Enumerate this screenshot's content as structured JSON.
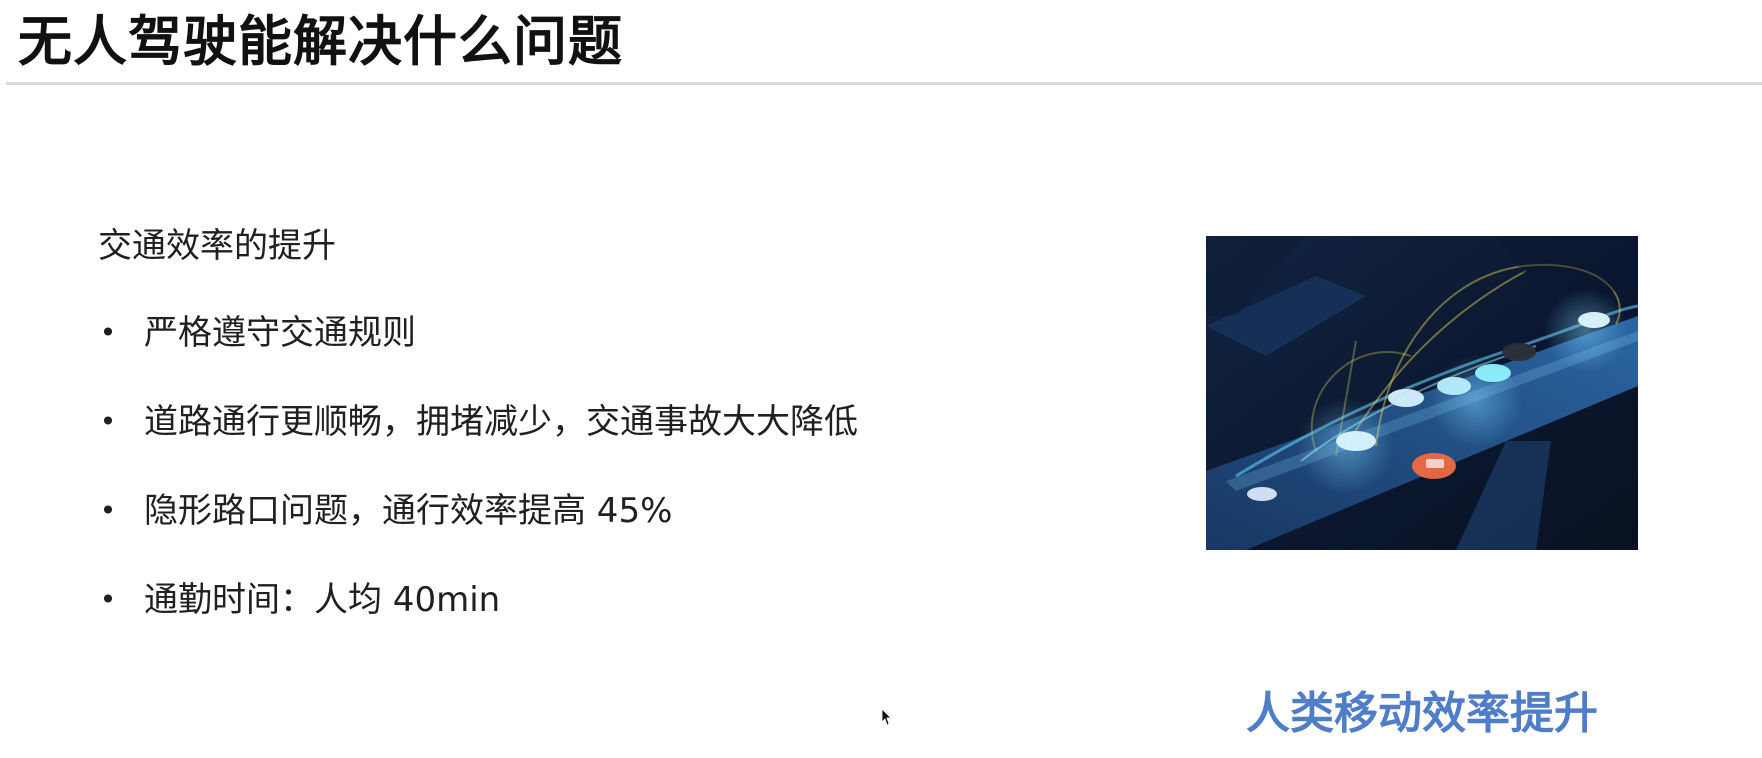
{
  "slide": {
    "title": "无人驾驶能解决什么问题",
    "section_heading": "交通效率的提升",
    "bullets": [
      {
        "text": "严格遵守交通规则"
      },
      {
        "text": "道路通行更顺畅，拥堵减少，交通事故大大降低"
      },
      {
        "text": "隐形路口问题，通行效率提高 45%"
      },
      {
        "text": "通勤时间：人均 40min"
      }
    ],
    "bullet_symbol": "•",
    "image_caption": "人类移动效率提升"
  },
  "colors": {
    "title": "#111111",
    "caption": "#4f7dc7",
    "rule": "#d8d8d8",
    "image_background": "#0b1730"
  },
  "icons": {
    "cursor": "mouse-pointer-icon"
  }
}
